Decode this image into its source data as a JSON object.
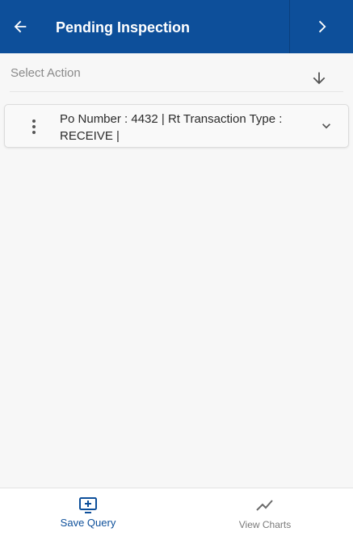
{
  "header": {
    "title": "Pending Inspection",
    "back_icon": "arrow-left-icon",
    "next_icon": "chevron-right-icon",
    "background": "#0d4f9a"
  },
  "action_bar": {
    "select_label": "Select Action",
    "sort_icon": "arrow-down-icon"
  },
  "records": [
    {
      "text": "Po Number : 4432 | Rt Transaction Type : RECEIVE |",
      "menu_icon": "kebab-menu-icon",
      "expand_icon": "chevron-down-icon"
    }
  ],
  "footer": {
    "tabs": [
      {
        "label": "Save Query",
        "icon": "monitor-add-icon",
        "color": "#0d4f9a"
      },
      {
        "label": "View Charts",
        "icon": "line-chart-icon",
        "color": "#7a7a7a"
      }
    ]
  }
}
